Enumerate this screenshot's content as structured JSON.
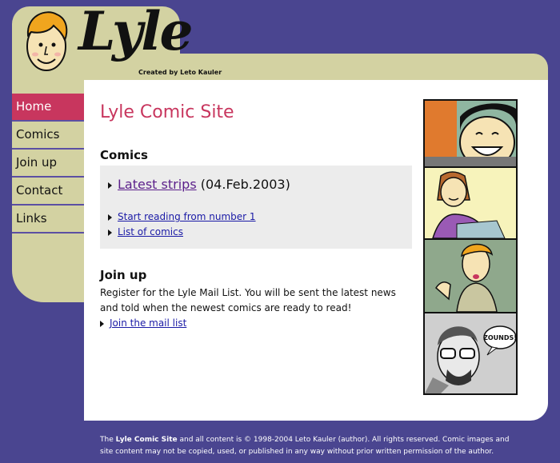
{
  "header": {
    "logo_text": "Lyle",
    "credit": "Created by Leto Kauler"
  },
  "nav": [
    {
      "label": "Home",
      "active": true
    },
    {
      "label": "Comics",
      "active": false
    },
    {
      "label": "Join up",
      "active": false
    },
    {
      "label": "Contact",
      "active": false
    },
    {
      "label": "Links",
      "active": false
    }
  ],
  "main": {
    "title": "Lyle Comic Site",
    "comics": {
      "heading": "Comics",
      "latest_link": "Latest strips",
      "latest_date": "(04.Feb.2003)",
      "start_link": "Start reading from number 1",
      "list_link": "List of comics"
    },
    "join": {
      "heading": "Join up",
      "text": "Register for the Lyle Mail List. You will be sent the latest news and told when the newest comics are ready to read!",
      "link": "Join the mail list"
    }
  },
  "strip": {
    "speech": "ZOUNDS!"
  },
  "footer": {
    "pre": "The ",
    "site": "Lyle Comic Site",
    "post": " and all content is © 1998-2004 Leto Kauler (author). All rights reserved. Comic images and site content may not be copied, used, or published in any way without prior written permission of the author."
  },
  "colors": {
    "background": "#4a4590",
    "panel": "#d3d2a2",
    "accent": "#c8365e",
    "link": "#1a1aa6"
  }
}
